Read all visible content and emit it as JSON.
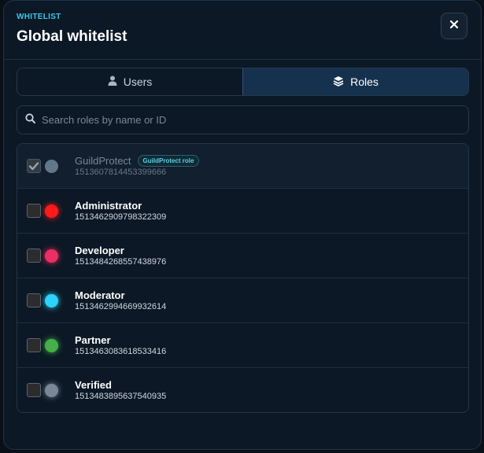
{
  "header": {
    "eyebrow": "WHITELIST",
    "title": "Global whitelist",
    "close_label": "×"
  },
  "tabs": [
    {
      "label": "Users",
      "icon": "user-icon",
      "active": false
    },
    {
      "label": "Roles",
      "icon": "layers-icon",
      "active": true
    }
  ],
  "search": {
    "placeholder": "Search roles by name or ID",
    "value": ""
  },
  "roles": [
    {
      "name": "GuildProtect",
      "id": "1513607814453399666",
      "color": "#63778a",
      "checked": true,
      "disabled": true,
      "badge": "GuildProtect role"
    },
    {
      "name": "Administrator",
      "id": "1513462909798322309",
      "color": "#ff1a1a",
      "checked": false,
      "disabled": false
    },
    {
      "name": "Developer",
      "id": "1513484268557438976",
      "color": "#ec2e62",
      "checked": false,
      "disabled": false
    },
    {
      "name": "Moderator",
      "id": "1513462994669932614",
      "color": "#2dd2ff",
      "checked": false,
      "disabled": false
    },
    {
      "name": "Partner",
      "id": "1513463083618533416",
      "color": "#45b04a",
      "checked": false,
      "disabled": false
    },
    {
      "name": "Verified",
      "id": "1513483895637540935",
      "color": "#788896",
      "checked": false,
      "disabled": false
    }
  ]
}
